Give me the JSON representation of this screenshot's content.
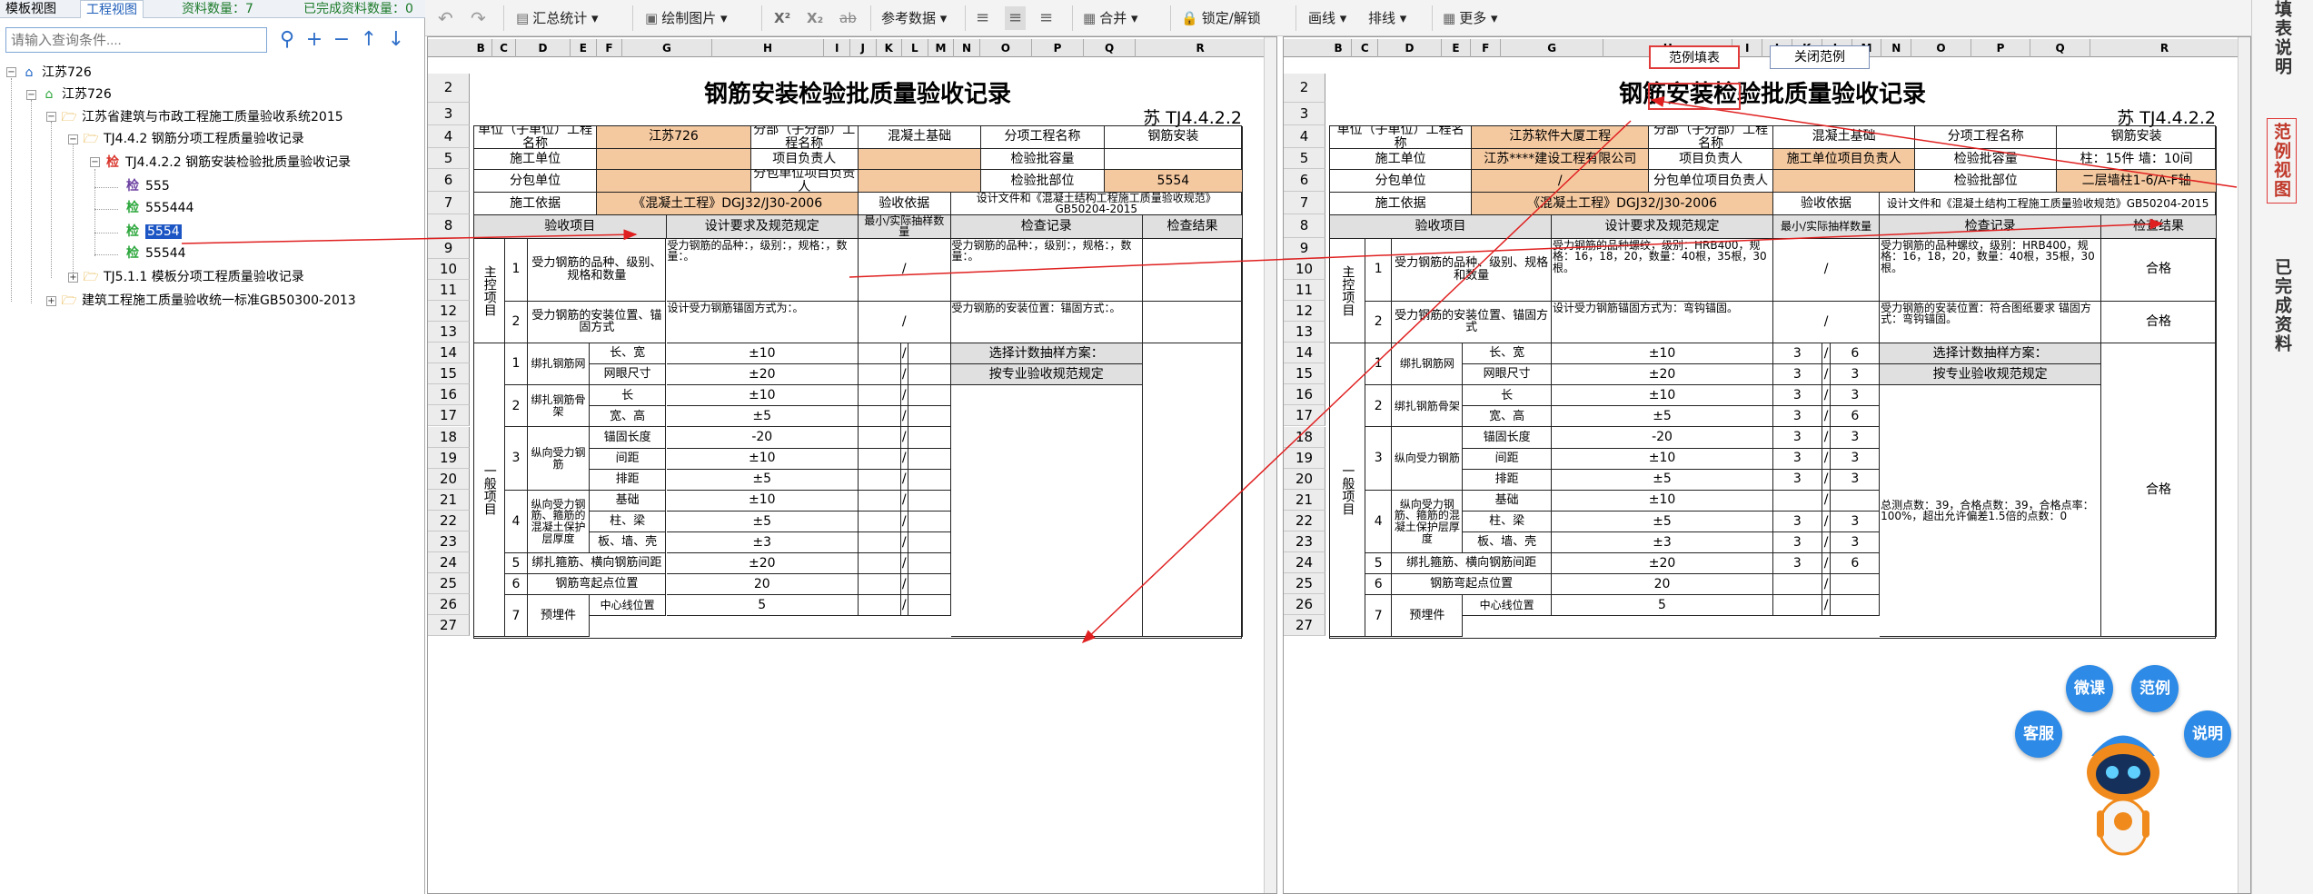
{
  "left_panel": {
    "tab_template": "模板视图",
    "tab_project": "工程视图",
    "count_label": "资料数量：7",
    "done_label": "已完成资料数量：0",
    "search_placeholder": "请输入查询条件....",
    "tree": [
      {
        "label": "江苏726",
        "level": 0,
        "icon": "home-blue-icon"
      },
      {
        "label": "江苏726",
        "level": 1,
        "icon": "home-green-icon"
      },
      {
        "label": "江苏省建筑与市政工程施工质量验收系统2015",
        "level": 2,
        "icon": "folder-icon"
      },
      {
        "label": "TJ4.4.2 钢筋分项工程质量验收记录",
        "level": 3,
        "icon": "folder-icon"
      },
      {
        "label": "TJ4.4.2.2 钢筋安装检验批质量验收记录",
        "level": 4,
        "icon": "check-red-icon"
      },
      {
        "label": "555",
        "level": 5,
        "icon": "check-stamp-icon"
      },
      {
        "label": "555444",
        "level": 5,
        "icon": "check-green-icon"
      },
      {
        "label": "5554",
        "level": 5,
        "icon": "check-green-icon",
        "selected": true
      },
      {
        "label": "55544",
        "level": 5,
        "icon": "check-green-icon"
      },
      {
        "label": "TJ5.1.1 模板分项工程质量验收记录",
        "level": 3,
        "icon": "folder-icon"
      },
      {
        "label": "建筑工程施工质量验收统一标准GB50300-2013",
        "level": 2,
        "icon": "folder-icon"
      }
    ]
  },
  "toolbar": {
    "summary": "汇总统计",
    "draw": "绘制图片",
    "superscript": "X²",
    "subscript": "X₂",
    "strike": "ab",
    "ref": "参考数据",
    "merge": "合并",
    "lock": "锁定/解锁",
    "line": "画线",
    "layout": "排线",
    "more": "更多"
  },
  "popups": {
    "example_fill": "范例填表",
    "close_example": "关闭范例"
  },
  "right_strip": {
    "table_desc": "填表说明",
    "example_view": "范例视图",
    "completed": "已完成资料"
  },
  "assistant": {
    "micro": "微课",
    "example": "范例",
    "service": "客服",
    "explain": "说明"
  },
  "col_headers": [
    "B",
    "C",
    "D",
    "E",
    "F",
    "G",
    "H",
    "I",
    "J",
    "K",
    "L",
    "M",
    "N",
    "O",
    "P",
    "Q",
    "R"
  ],
  "row_numbers": [
    "2",
    "3",
    "4",
    "5",
    "6",
    "7",
    "8",
    "9",
    "10",
    "11",
    "12",
    "13",
    "14",
    "15",
    "16",
    "17",
    "18",
    "19",
    "20",
    "21",
    "22",
    "23",
    "24",
    "25",
    "26",
    "27"
  ],
  "form": {
    "title": "钢筋安装检验批质量验收记录",
    "code": "苏 TJ4.4.2.2",
    "unit_label": "单位（子单位）工程名称",
    "division_label": "分部（子分部）工程名称",
    "subitem_label": "分项工程名称",
    "construction_unit_label": "施工单位",
    "project_lead_label": "项目负责人",
    "batch_capacity_label": "检验批容量",
    "subcontract_label": "分包单位",
    "sub_lead_label": "分包单位项目负责人",
    "batch_part_label": "检验批部位",
    "basis_label": "施工依据",
    "acceptance_basis_label": "验收依据",
    "basis_value": "《混凝土工程》DGJ32/J30-2006",
    "acceptance_value": "设计文件和《混凝土结构工程施工质量验收规范》GB50204-2015",
    "hdr_item": "验收项目",
    "hdr_design": "设计要求及规范规定",
    "hdr_sample": "最小/实际抽样数量",
    "hdr_record": "检查记录",
    "hdr_result": "检查结果",
    "main_control": "主控项目",
    "general": "一般项目",
    "mc1_name": "受力钢筋的品种、级别、规格和数量",
    "mc2_name": "受力钢筋的安装位置、锚固方式",
    "slash": "/",
    "g1": "绑扎钢筋网",
    "g1a": "长、宽",
    "g1b": "网眼尺寸",
    "g2": "绑扎钢筋骨架",
    "g2a": "长",
    "g2b": "宽、高",
    "g3": "纵向受力钢筋",
    "g3a": "锚固长度",
    "g3b": "间距",
    "g3c": "排距",
    "g4": "纵向受力钢筋、箍筋的混凝土保护层厚度",
    "g4a": "基础",
    "g4b": "柱、梁",
    "g4c": "板、墙、壳",
    "g5": "绑扎箍筋、横向钢筋间距",
    "g6": "钢筋弯起点位置",
    "g7": "预埋件",
    "g7a": "中心线位置",
    "tol": [
      "±10",
      "±20",
      "±10",
      "±5",
      "-20",
      "±10",
      "±5",
      "±10",
      "±5",
      "±3",
      "±20",
      "20",
      "5"
    ],
    "n1": "1",
    "n2": "2",
    "n3": "3",
    "n4": "4",
    "n5": "5",
    "n6": "6",
    "n7": "7"
  },
  "left_sheet": {
    "unit": "江苏726",
    "division": "混凝土基础",
    "subitem": "钢筋安装",
    "batch_part": "5554",
    "mc1_design": "受力钢筋的品种：，级别：，规格：，数量：。",
    "mc1_record": "受力钢筋的品种：，级别：，规格：，数量：。",
    "mc2_design": "设计受力钢筋锚固方式为：。",
    "mc2_record": "受力钢筋的安装位置：锚固方式：。",
    "plan_label": "选择计数抽样方案：",
    "plan_value": "按专业验收规范规定"
  },
  "right_sheet": {
    "unit": "江苏软件大厦工程",
    "division": "混凝土基础",
    "subitem": "钢筋安装",
    "construction_unit": "江苏****建设工程有限公司",
    "project_lead_value": "施工单位项目负责人",
    "batch_capacity": "柱：15件 墙：10间",
    "subcontract": "/",
    "batch_part": "二层墙柱1-6/A-F轴",
    "mc1_design": "受力钢筋的品种螺纹，级别：HRB400，规格：16，18，20，数量：40根，35根，30根。",
    "mc1_record": "受力钢筋的品种螺纹，级别：HRB400，规格：16，18，20，数量：40根，35根，30根。",
    "mc1_result": "合格",
    "mc2_design": "设计受力钢筋锚固方式为：弯钩锚固。",
    "mc2_record": "受力钢筋的安装位置：符合图纸要求 锚固方式：弯钩锚固。",
    "mc2_result": "合格",
    "plan_label": "选择计数抽样方案：",
    "plan_value": "按专业验收规范规定",
    "summary": "总测点数：39，合格点数：39，合格点率：100%，超出允许偏差1.5倍的点数：0",
    "general_result": "合格",
    "samples": [
      [
        "3",
        "6"
      ],
      [
        "3",
        "3"
      ],
      [
        "3",
        "3"
      ],
      [
        "3",
        "6"
      ],
      [
        "3",
        "3"
      ],
      [
        "3",
        "3"
      ],
      [
        "3",
        "3"
      ],
      [
        "",
        ""
      ],
      [
        "3",
        "3"
      ],
      [
        "3",
        "3"
      ],
      [
        "3",
        "6"
      ],
      [
        "",
        ""
      ],
      [
        "",
        ""
      ]
    ]
  }
}
